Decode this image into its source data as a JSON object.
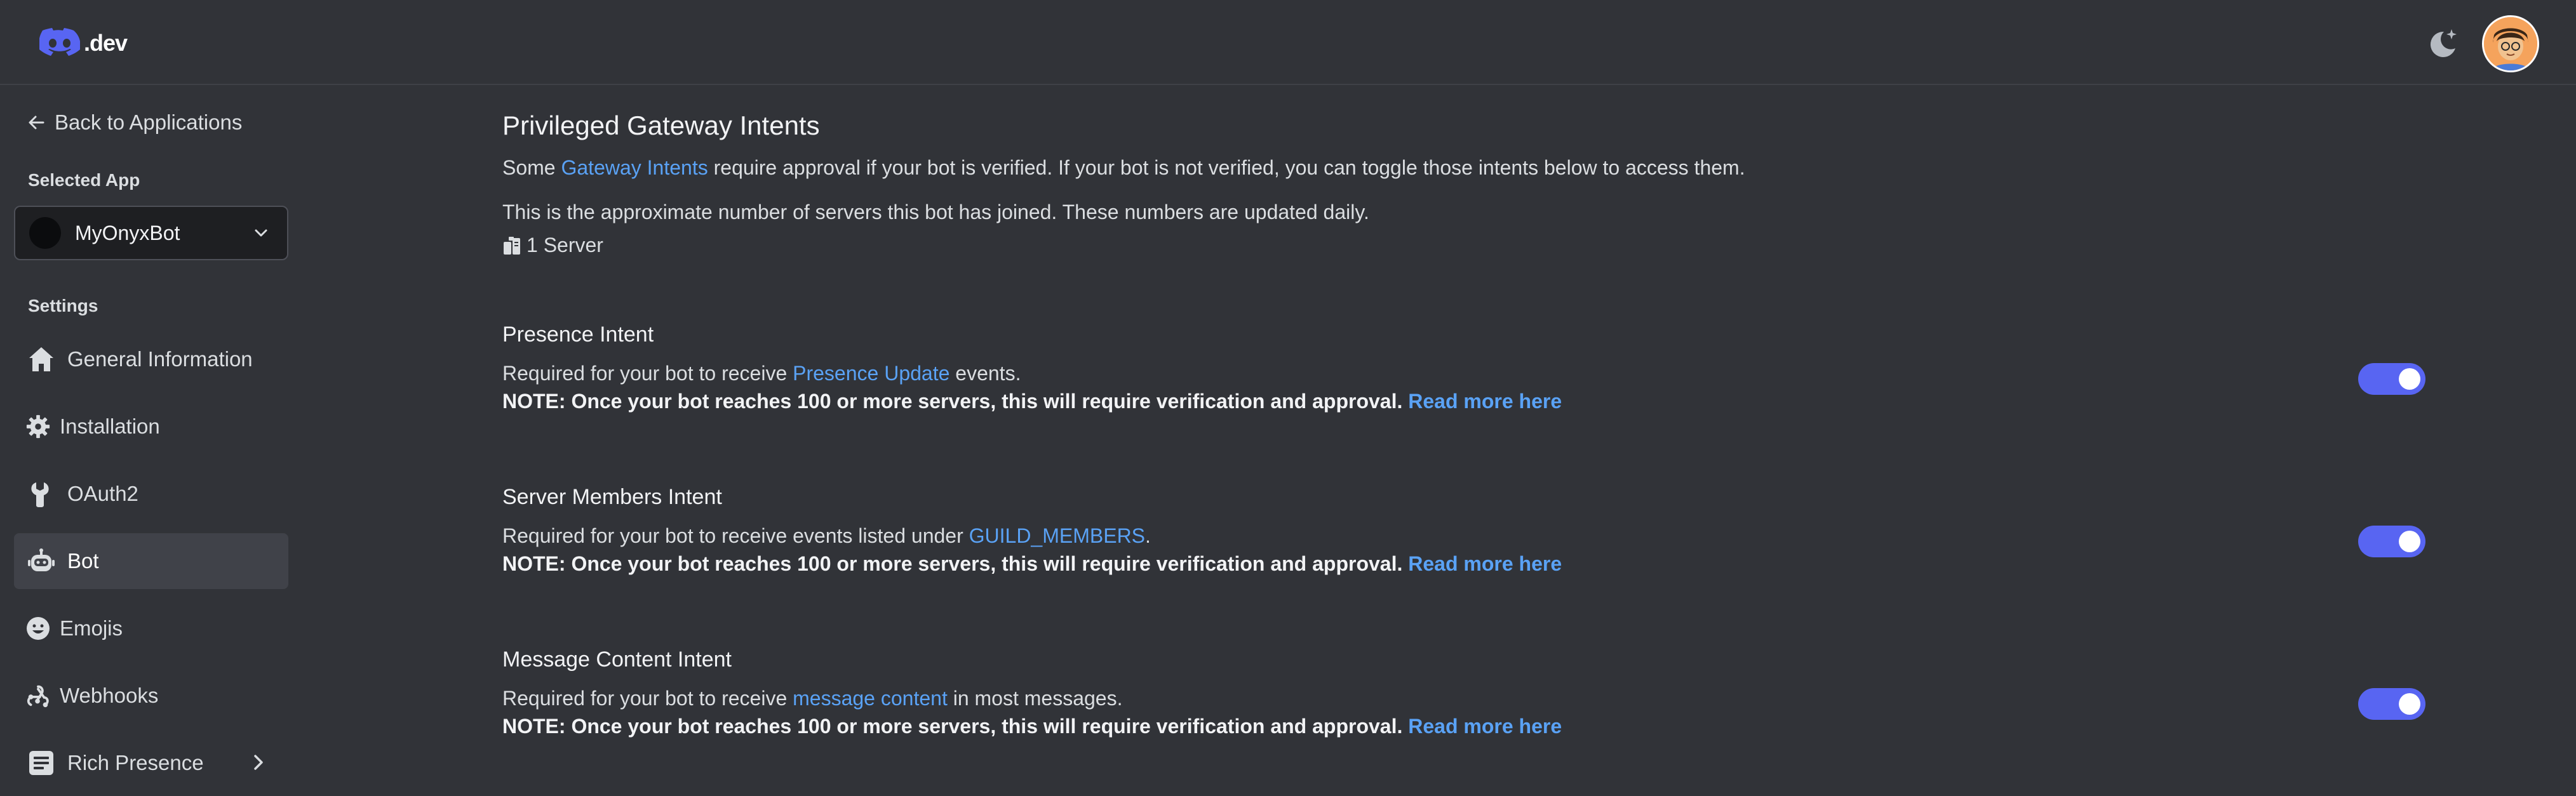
{
  "header": {
    "logo_text": ".dev",
    "theme_icon": "moon-sparkle-icon",
    "avatar_icon": "user-avatar"
  },
  "sidebar": {
    "back_label": "Back to Applications",
    "selected_app_label": "Selected App",
    "selected_app": "MyOnyxBot",
    "settings_label": "Settings",
    "items": [
      {
        "label": "General Information",
        "icon": "home-icon"
      },
      {
        "label": "Installation",
        "icon": "gear-icon"
      },
      {
        "label": "OAuth2",
        "icon": "wrench-icon"
      },
      {
        "label": "Bot",
        "icon": "bot-icon",
        "active": true
      },
      {
        "label": "Emojis",
        "icon": "smiley-icon"
      },
      {
        "label": "Webhooks",
        "icon": "webhook-icon"
      },
      {
        "label": "Rich Presence",
        "icon": "rich-presence-icon"
      }
    ]
  },
  "main": {
    "title": "Privileged Gateway Intents",
    "intro_before": "Some ",
    "intro_link": "Gateway Intents",
    "intro_after": " require approval if your bot is verified. If your bot is not verified, you can toggle those intents below to access them.",
    "servers_desc": "This is the approximate number of servers this bot has joined. These numbers are updated daily.",
    "server_count": "1 Server",
    "intents": [
      {
        "title": "Presence Intent",
        "desc_before": "Required for your bot to receive ",
        "desc_link": "Presence Update",
        "desc_after": " events.",
        "note": "NOTE: Once your bot reaches 100 or more servers, this will require verification and approval.",
        "read_more": "Read more here",
        "enabled": true
      },
      {
        "title": "Server Members Intent",
        "desc_before": "Required for your bot to receive events listed under ",
        "desc_link": "GUILD_MEMBERS",
        "desc_after": ".",
        "note": "NOTE: Once your bot reaches 100 or more servers, this will require verification and approval.",
        "read_more": "Read more here",
        "enabled": true
      },
      {
        "title": "Message Content Intent",
        "desc_before": "Required for your bot to receive ",
        "desc_link": "message content",
        "desc_after": " in most messages.",
        "note": "NOTE: Once your bot reaches 100 or more servers, this will require verification and approval.",
        "read_more": "Read more here",
        "enabled": true
      }
    ]
  },
  "colors": {
    "background": "#313338",
    "link": "#5aa2f5",
    "toggle_on": "#5865f2",
    "active_nav": "#404249"
  }
}
